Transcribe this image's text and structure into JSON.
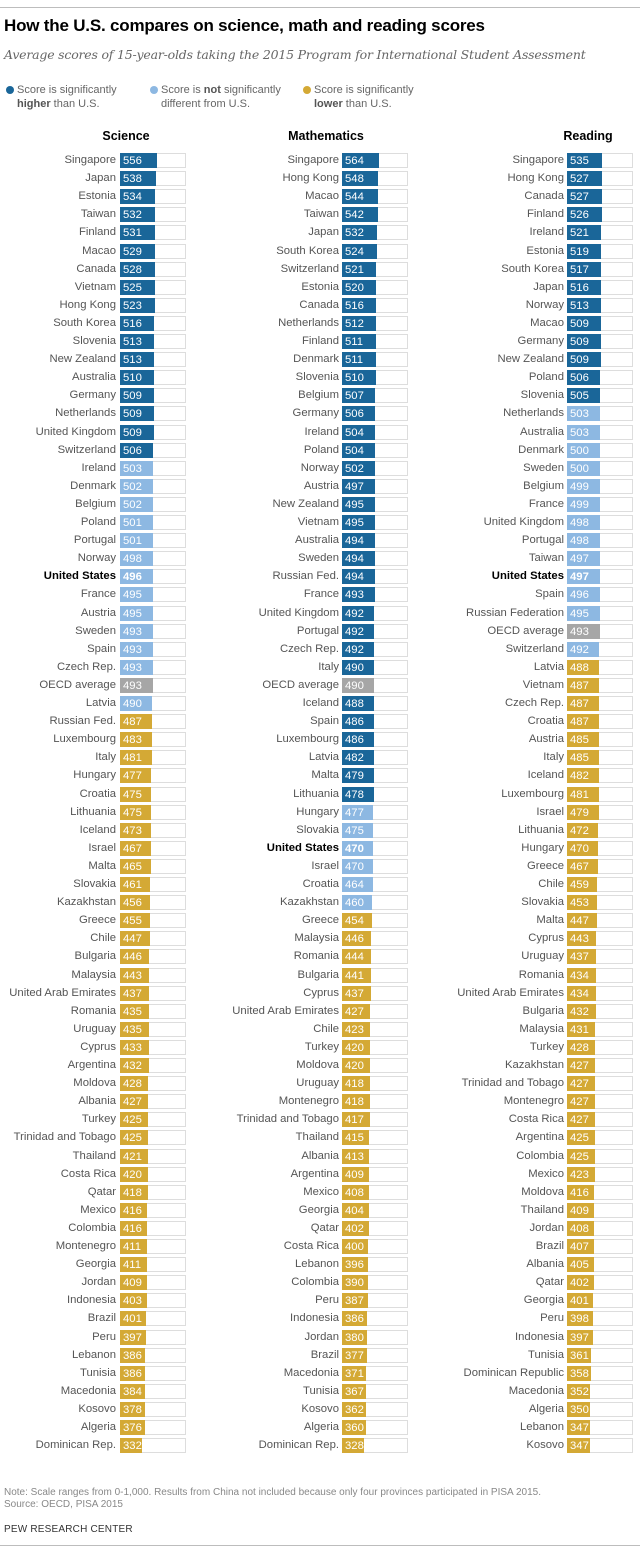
{
  "header": {
    "title": "How the U.S. compares on science, math and reading scores",
    "subtitle": "Average scores of 15-year-olds taking the 2015 Program for International Student Assessment"
  },
  "legend": [
    {
      "key": "higher",
      "line1_pre": "Score is significantly",
      "line1_bold": "",
      "line1_post": "",
      "line2_bold": "higher",
      "line2_post": " than U.S.",
      "color": "#1a6699"
    },
    {
      "key": "same",
      "line1_pre": "Score is ",
      "line1_bold": "not",
      "line1_post": " significantly",
      "line2_bold": "",
      "line2_post": "different from U.S.",
      "color": "#8db8e2"
    },
    {
      "key": "lower",
      "line1_pre": "Score is significantly",
      "line1_bold": "",
      "line1_post": "",
      "line2_bold": "lower",
      "line2_post": " than U.S.",
      "color": "#d4a935"
    }
  ],
  "colors": {
    "higher": "#1a6699",
    "same": "#8db8e2",
    "lower": "#d4a935",
    "oecd": "#a6a6a6"
  },
  "footer": {
    "note": "Note: Scale ranges from 0-1,000. Results from China not included because only four provinces participated in PISA 2015.",
    "source": "Source: OECD, PISA 2015",
    "brand": "PEW RESEARCH CENTER"
  },
  "chart_data": [
    {
      "type": "bar",
      "title": "Science",
      "xlim": [
        0,
        1000
      ],
      "rows": [
        [
          "Singapore",
          556,
          "higher"
        ],
        [
          "Japan",
          538,
          "higher"
        ],
        [
          "Estonia",
          534,
          "higher"
        ],
        [
          "Taiwan",
          532,
          "higher"
        ],
        [
          "Finland",
          531,
          "higher"
        ],
        [
          "Macao",
          529,
          "higher"
        ],
        [
          "Canada",
          528,
          "higher"
        ],
        [
          "Vietnam",
          525,
          "higher"
        ],
        [
          "Hong Kong",
          523,
          "higher"
        ],
        [
          "South Korea",
          516,
          "higher"
        ],
        [
          "Slovenia",
          513,
          "higher"
        ],
        [
          "New Zealand",
          513,
          "higher"
        ],
        [
          "Australia",
          510,
          "higher"
        ],
        [
          "Germany",
          509,
          "higher"
        ],
        [
          "Netherlands",
          509,
          "higher"
        ],
        [
          "United Kingdom",
          509,
          "higher"
        ],
        [
          "Switzerland",
          506,
          "higher"
        ],
        [
          "Ireland",
          503,
          "same"
        ],
        [
          "Denmark",
          502,
          "same"
        ],
        [
          "Belgium",
          502,
          "same"
        ],
        [
          "Poland",
          501,
          "same"
        ],
        [
          "Portugal",
          501,
          "same"
        ],
        [
          "Norway",
          498,
          "same"
        ],
        [
          "United States",
          496,
          "us"
        ],
        [
          "France",
          495,
          "same"
        ],
        [
          "Austria",
          495,
          "same"
        ],
        [
          "Sweden",
          493,
          "same"
        ],
        [
          "Spain",
          493,
          "same"
        ],
        [
          "Czech Rep.",
          493,
          "same"
        ],
        [
          "OECD average",
          493,
          "oecd"
        ],
        [
          "Latvia",
          490,
          "same"
        ],
        [
          "Russian Fed.",
          487,
          "lower"
        ],
        [
          "Luxembourg",
          483,
          "lower"
        ],
        [
          "Italy",
          481,
          "lower"
        ],
        [
          "Hungary",
          477,
          "lower"
        ],
        [
          "Croatia",
          475,
          "lower"
        ],
        [
          "Lithuania",
          475,
          "lower"
        ],
        [
          "Iceland",
          473,
          "lower"
        ],
        [
          "Israel",
          467,
          "lower"
        ],
        [
          "Malta",
          465,
          "lower"
        ],
        [
          "Slovakia",
          461,
          "lower"
        ],
        [
          "Kazakhstan",
          456,
          "lower"
        ],
        [
          "Greece",
          455,
          "lower"
        ],
        [
          "Chile",
          447,
          "lower"
        ],
        [
          "Bulgaria",
          446,
          "lower"
        ],
        [
          "Malaysia",
          443,
          "lower"
        ],
        [
          "United Arab Emirates",
          437,
          "lower"
        ],
        [
          "Romania",
          435,
          "lower"
        ],
        [
          "Uruguay",
          435,
          "lower"
        ],
        [
          "Cyprus",
          433,
          "lower"
        ],
        [
          "Argentina",
          432,
          "lower"
        ],
        [
          "Moldova",
          428,
          "lower"
        ],
        [
          "Albania",
          427,
          "lower"
        ],
        [
          "Turkey",
          425,
          "lower"
        ],
        [
          "Trinidad and Tobago",
          425,
          "lower"
        ],
        [
          "Thailand",
          421,
          "lower"
        ],
        [
          "Costa Rica",
          420,
          "lower"
        ],
        [
          "Qatar",
          418,
          "lower"
        ],
        [
          "Mexico",
          416,
          "lower"
        ],
        [
          "Colombia",
          416,
          "lower"
        ],
        [
          "Montenegro",
          411,
          "lower"
        ],
        [
          "Georgia",
          411,
          "lower"
        ],
        [
          "Jordan",
          409,
          "lower"
        ],
        [
          "Indonesia",
          403,
          "lower"
        ],
        [
          "Brazil",
          401,
          "lower"
        ],
        [
          "Peru",
          397,
          "lower"
        ],
        [
          "Lebanon",
          386,
          "lower"
        ],
        [
          "Tunisia",
          386,
          "lower"
        ],
        [
          "Macedonia",
          384,
          "lower"
        ],
        [
          "Kosovo",
          378,
          "lower"
        ],
        [
          "Algeria",
          376,
          "lower"
        ],
        [
          "Dominican Rep.",
          332,
          "lower"
        ]
      ]
    },
    {
      "type": "bar",
      "title": "Mathematics",
      "xlim": [
        0,
        1000
      ],
      "rows": [
        [
          "Singapore",
          564,
          "higher"
        ],
        [
          "Hong Kong",
          548,
          "higher"
        ],
        [
          "Macao",
          544,
          "higher"
        ],
        [
          "Taiwan",
          542,
          "higher"
        ],
        [
          "Japan",
          532,
          "higher"
        ],
        [
          "South Korea",
          524,
          "higher"
        ],
        [
          "Switzerland",
          521,
          "higher"
        ],
        [
          "Estonia",
          520,
          "higher"
        ],
        [
          "Canada",
          516,
          "higher"
        ],
        [
          "Netherlands",
          512,
          "higher"
        ],
        [
          "Finland",
          511,
          "higher"
        ],
        [
          "Denmark",
          511,
          "higher"
        ],
        [
          "Slovenia",
          510,
          "higher"
        ],
        [
          "Belgium",
          507,
          "higher"
        ],
        [
          "Germany",
          506,
          "higher"
        ],
        [
          "Ireland",
          504,
          "higher"
        ],
        [
          "Poland",
          504,
          "higher"
        ],
        [
          "Norway",
          502,
          "higher"
        ],
        [
          "Austria",
          497,
          "higher"
        ],
        [
          "New Zealand",
          495,
          "higher"
        ],
        [
          "Vietnam",
          495,
          "higher"
        ],
        [
          "Australia",
          494,
          "higher"
        ],
        [
          "Sweden",
          494,
          "higher"
        ],
        [
          "Russian Fed.",
          494,
          "higher"
        ],
        [
          "France",
          493,
          "higher"
        ],
        [
          "United Kingdom",
          492,
          "higher"
        ],
        [
          "Portugal",
          492,
          "higher"
        ],
        [
          "Czech Rep.",
          492,
          "higher"
        ],
        [
          "Italy",
          490,
          "higher"
        ],
        [
          "OECD average",
          490,
          "oecd"
        ],
        [
          "Iceland",
          488,
          "higher"
        ],
        [
          "Spain",
          486,
          "higher"
        ],
        [
          "Luxembourg",
          486,
          "higher"
        ],
        [
          "Latvia",
          482,
          "higher"
        ],
        [
          "Malta",
          479,
          "higher"
        ],
        [
          "Lithuania",
          478,
          "higher"
        ],
        [
          "Hungary",
          477,
          "same"
        ],
        [
          "Slovakia",
          475,
          "same"
        ],
        [
          "United States",
          470,
          "us"
        ],
        [
          "Israel",
          470,
          "same"
        ],
        [
          "Croatia",
          464,
          "same"
        ],
        [
          "Kazakhstan",
          460,
          "same"
        ],
        [
          "Greece",
          454,
          "lower"
        ],
        [
          "Malaysia",
          446,
          "lower"
        ],
        [
          "Romania",
          444,
          "lower"
        ],
        [
          "Bulgaria",
          441,
          "lower"
        ],
        [
          "Cyprus",
          437,
          "lower"
        ],
        [
          "United Arab Emirates",
          427,
          "lower"
        ],
        [
          "Chile",
          423,
          "lower"
        ],
        [
          "Turkey",
          420,
          "lower"
        ],
        [
          "Moldova",
          420,
          "lower"
        ],
        [
          "Uruguay",
          418,
          "lower"
        ],
        [
          "Montenegro",
          418,
          "lower"
        ],
        [
          "Trinidad and Tobago",
          417,
          "lower"
        ],
        [
          "Thailand",
          415,
          "lower"
        ],
        [
          "Albania",
          413,
          "lower"
        ],
        [
          "Argentina",
          409,
          "lower"
        ],
        [
          "Mexico",
          408,
          "lower"
        ],
        [
          "Georgia",
          404,
          "lower"
        ],
        [
          "Qatar",
          402,
          "lower"
        ],
        [
          "Costa Rica",
          400,
          "lower"
        ],
        [
          "Lebanon",
          396,
          "lower"
        ],
        [
          "Colombia",
          390,
          "lower"
        ],
        [
          "Peru",
          387,
          "lower"
        ],
        [
          "Indonesia",
          386,
          "lower"
        ],
        [
          "Jordan",
          380,
          "lower"
        ],
        [
          "Brazil",
          377,
          "lower"
        ],
        [
          "Macedonia",
          371,
          "lower"
        ],
        [
          "Tunisia",
          367,
          "lower"
        ],
        [
          "Kosovo",
          362,
          "lower"
        ],
        [
          "Algeria",
          360,
          "lower"
        ],
        [
          "Dominican Rep.",
          328,
          "lower"
        ]
      ]
    },
    {
      "type": "bar",
      "title": "Reading",
      "xlim": [
        0,
        1000
      ],
      "rows": [
        [
          "Singapore",
          535,
          "higher"
        ],
        [
          "Hong Kong",
          527,
          "higher"
        ],
        [
          "Canada",
          527,
          "higher"
        ],
        [
          "Finland",
          526,
          "higher"
        ],
        [
          "Ireland",
          521,
          "higher"
        ],
        [
          "Estonia",
          519,
          "higher"
        ],
        [
          "South Korea",
          517,
          "higher"
        ],
        [
          "Japan",
          516,
          "higher"
        ],
        [
          "Norway",
          513,
          "higher"
        ],
        [
          "Macao",
          509,
          "higher"
        ],
        [
          "Germany",
          509,
          "higher"
        ],
        [
          "New Zealand",
          509,
          "higher"
        ],
        [
          "Poland",
          506,
          "higher"
        ],
        [
          "Slovenia",
          505,
          "higher"
        ],
        [
          "Netherlands",
          503,
          "same"
        ],
        [
          "Australia",
          503,
          "same"
        ],
        [
          "Denmark",
          500,
          "same"
        ],
        [
          "Sweden",
          500,
          "same"
        ],
        [
          "Belgium",
          499,
          "same"
        ],
        [
          "France",
          499,
          "same"
        ],
        [
          "United Kingdom",
          498,
          "same"
        ],
        [
          "Portugal",
          498,
          "same"
        ],
        [
          "Taiwan",
          497,
          "same"
        ],
        [
          "United States",
          497,
          "us"
        ],
        [
          "Spain",
          496,
          "same"
        ],
        [
          "Russian Federation",
          495,
          "same"
        ],
        [
          "OECD average",
          493,
          "oecd"
        ],
        [
          "Switzerland",
          492,
          "same"
        ],
        [
          "Latvia",
          488,
          "lower"
        ],
        [
          "Vietnam",
          487,
          "lower"
        ],
        [
          "Czech Rep.",
          487,
          "lower"
        ],
        [
          "Croatia",
          487,
          "lower"
        ],
        [
          "Austria",
          485,
          "lower"
        ],
        [
          "Italy",
          485,
          "lower"
        ],
        [
          "Iceland",
          482,
          "lower"
        ],
        [
          "Luxembourg",
          481,
          "lower"
        ],
        [
          "Israel",
          479,
          "lower"
        ],
        [
          "Lithuania",
          472,
          "lower"
        ],
        [
          "Hungary",
          470,
          "lower"
        ],
        [
          "Greece",
          467,
          "lower"
        ],
        [
          "Chile",
          459,
          "lower"
        ],
        [
          "Slovakia",
          453,
          "lower"
        ],
        [
          "Malta",
          447,
          "lower"
        ],
        [
          "Cyprus",
          443,
          "lower"
        ],
        [
          "Uruguay",
          437,
          "lower"
        ],
        [
          "Romania",
          434,
          "lower"
        ],
        [
          "United Arab Emirates",
          434,
          "lower"
        ],
        [
          "Bulgaria",
          432,
          "lower"
        ],
        [
          "Malaysia",
          431,
          "lower"
        ],
        [
          "Turkey",
          428,
          "lower"
        ],
        [
          "Kazakhstan",
          427,
          "lower"
        ],
        [
          "Trinidad and Tobago",
          427,
          "lower"
        ],
        [
          "Montenegro",
          427,
          "lower"
        ],
        [
          "Costa Rica",
          427,
          "lower"
        ],
        [
          "Argentina",
          425,
          "lower"
        ],
        [
          "Colombia",
          425,
          "lower"
        ],
        [
          "Mexico",
          423,
          "lower"
        ],
        [
          "Moldova",
          416,
          "lower"
        ],
        [
          "Thailand",
          409,
          "lower"
        ],
        [
          "Jordan",
          408,
          "lower"
        ],
        [
          "Brazil",
          407,
          "lower"
        ],
        [
          "Albania",
          405,
          "lower"
        ],
        [
          "Qatar",
          402,
          "lower"
        ],
        [
          "Georgia",
          401,
          "lower"
        ],
        [
          "Peru",
          398,
          "lower"
        ],
        [
          "Indonesia",
          397,
          "lower"
        ],
        [
          "Tunisia",
          361,
          "lower"
        ],
        [
          "Dominican Republic",
          358,
          "lower"
        ],
        [
          "Macedonia",
          352,
          "lower"
        ],
        [
          "Algeria",
          350,
          "lower"
        ],
        [
          "Lebanon",
          347,
          "lower"
        ],
        [
          "Kosovo",
          347,
          "lower"
        ]
      ]
    }
  ]
}
